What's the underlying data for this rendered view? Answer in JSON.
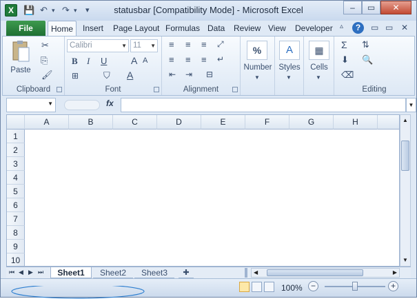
{
  "window": {
    "title": "statusbar  [Compatibility Mode]  -  Microsoft Excel",
    "app_icon": "X"
  },
  "quick_access": {
    "save": "💾",
    "undo": "↶",
    "redo": "↷",
    "custom": "▾"
  },
  "window_controls": {
    "minimize": "–",
    "restore": "▭",
    "close": "✕"
  },
  "ribbon_tabs": {
    "file": "File",
    "home": "Home",
    "insert": "Insert",
    "page_layout": "Page Layout",
    "formulas": "Formulas",
    "data": "Data",
    "review": "Review",
    "view": "View",
    "developer": "Developer"
  },
  "ribbon_controls": {
    "help": "?",
    "minimize_ribbon": "▭",
    "restore_doc": "▭",
    "close_doc": "✕"
  },
  "groups": {
    "clipboard": {
      "label": "Clipboard",
      "paste": "Paste"
    },
    "font": {
      "label": "Font",
      "font_name": "Calibri",
      "font_size": "11",
      "bold": "B",
      "italic": "I",
      "underline": "U",
      "grow": "A",
      "shrink": "A",
      "color": "A"
    },
    "alignment": {
      "label": "Alignment"
    },
    "number": {
      "label": "Number",
      "icon": "%"
    },
    "styles": {
      "label": "Styles"
    },
    "cells": {
      "label": "Cells"
    },
    "editing": {
      "label": "Editing",
      "sum": "Σ"
    }
  },
  "formula_bar": {
    "fx": "fx",
    "name_value": "",
    "formula_value": ""
  },
  "columns": [
    "A",
    "B",
    "C",
    "D",
    "E",
    "F",
    "G",
    "H",
    "I"
  ],
  "rows": [
    "1",
    "2",
    "3",
    "4",
    "5",
    "6",
    "7",
    "8",
    "9",
    "10"
  ],
  "sheets": [
    "Sheet1",
    "Sheet2",
    "Sheet3"
  ],
  "status": {
    "zoom": "100%",
    "zoom_out": "−",
    "zoom_in": "+",
    "zoom_level": 1.0
  }
}
